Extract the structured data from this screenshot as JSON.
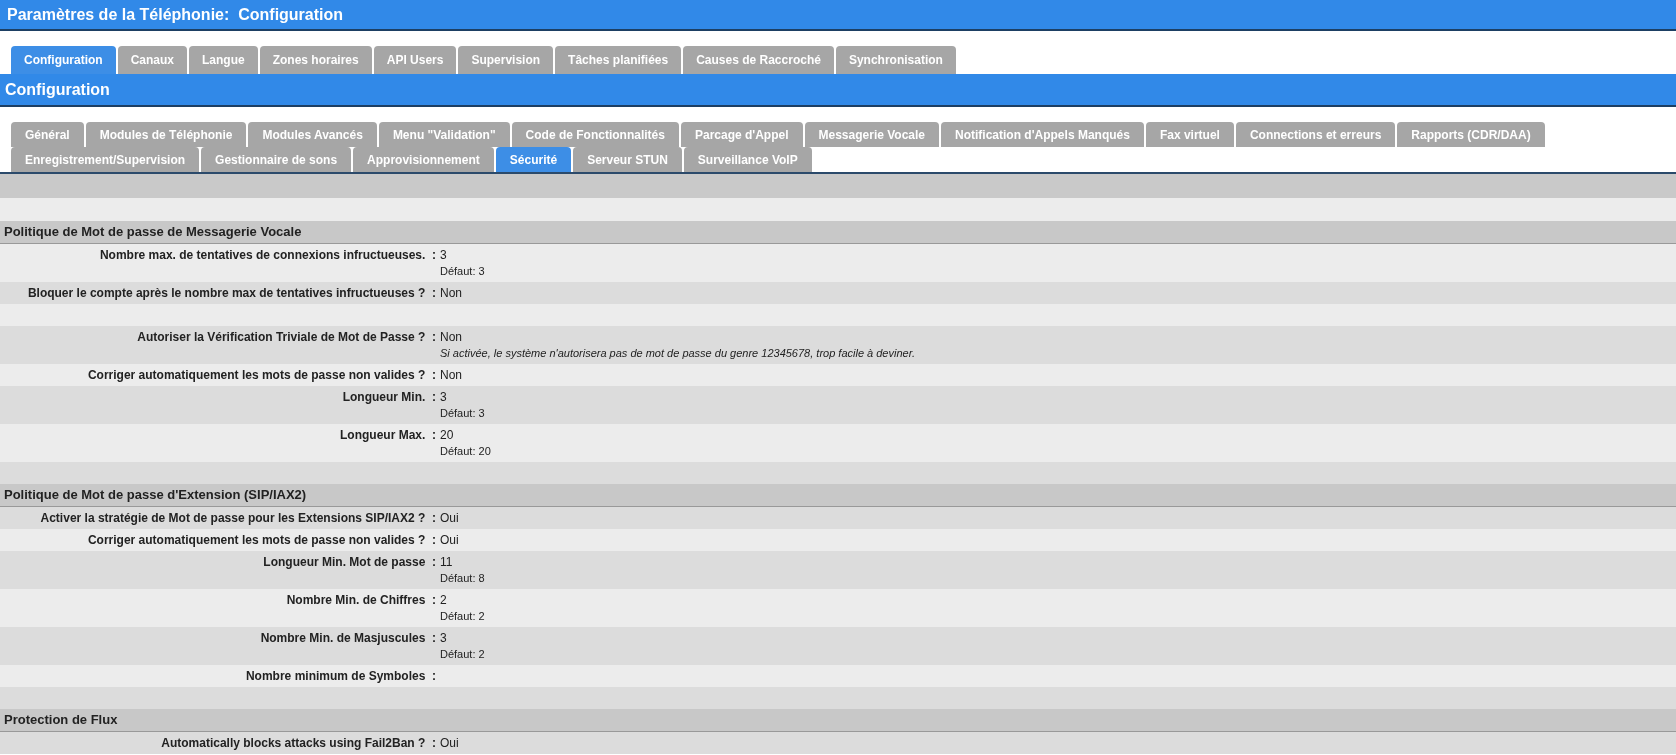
{
  "window": {
    "title": "Paramètres de la Téléphonie:  Configuration"
  },
  "tabs": [
    {
      "label": "Configuration",
      "selected": true
    },
    {
      "label": "Canaux",
      "selected": false
    },
    {
      "label": "Langue",
      "selected": false
    },
    {
      "label": "Zones horaires",
      "selected": false
    },
    {
      "label": "API Users",
      "selected": false
    },
    {
      "label": "Supervision",
      "selected": false
    },
    {
      "label": "Tâches planifiées",
      "selected": false
    },
    {
      "label": "Causes de Raccroché",
      "selected": false
    },
    {
      "label": "Synchronisation",
      "selected": false
    }
  ],
  "panel": {
    "title": "Configuration"
  },
  "section_tabs": [
    {
      "label": "Général",
      "selected": false
    },
    {
      "label": "Modules de Téléphonie",
      "selected": false
    },
    {
      "label": "Modules Avancés",
      "selected": false
    },
    {
      "label": "Menu \"Validation\"",
      "selected": false
    },
    {
      "label": "Code de Fonctionnalités",
      "selected": false
    },
    {
      "label": "Parcage d'Appel",
      "selected": false
    },
    {
      "label": "Messagerie Vocale",
      "selected": false
    },
    {
      "label": "Notification d'Appels Manqués",
      "selected": false
    },
    {
      "label": "Fax virtuel",
      "selected": false
    },
    {
      "label": "Connections et erreurs",
      "selected": false
    },
    {
      "label": "Rapports (CDR/DAA)",
      "selected": false
    },
    {
      "label": "Enregistrement/Supervision",
      "selected": false
    },
    {
      "label": "Gestionnaire de sons",
      "selected": false
    },
    {
      "label": "Approvisionnement",
      "selected": false
    },
    {
      "label": "Sécurité",
      "selected": true
    },
    {
      "label": "Serveur STUN",
      "selected": false
    },
    {
      "label": "Surveillance VoIP",
      "selected": false
    }
  ],
  "sections": [
    {
      "title": "Politique de Mot de passe de Messagerie Vocale",
      "rows": [
        {
          "kind": "field",
          "label": "Nombre max. de tentatives de connexions infructueuses.  :",
          "value": "3",
          "default": "Défaut: 3"
        },
        {
          "kind": "field",
          "label": "Bloquer le compte après le nombre max de tentatives infructueuses ?  :",
          "value": "Non"
        },
        {
          "kind": "spacer"
        },
        {
          "kind": "field",
          "label": "Autoriser la Vérification Triviale de Mot de Passe ?  :",
          "value": "Non",
          "note": "Si activée, le système n'autorisera pas de mot de passe du genre 12345678, trop facile à deviner."
        },
        {
          "kind": "field",
          "label": "Corriger automatiquement les mots de passe non valides ?  :",
          "value": "Non"
        },
        {
          "kind": "field",
          "label": "Longueur Min.  :",
          "value": "3",
          "default": "Défaut: 3"
        },
        {
          "kind": "field",
          "label": "Longueur Max.  :",
          "value": "20",
          "default": "Défaut: 20"
        },
        {
          "kind": "spacer"
        }
      ]
    },
    {
      "title": "Politique de Mot de passe d'Extension (SIP/IAX2)",
      "rows": [
        {
          "kind": "field",
          "label": "Activer la stratégie de Mot de passe pour les Extensions SIP/IAX2 ?  :",
          "value": "Oui"
        },
        {
          "kind": "field",
          "label": "Corriger automatiquement les mots de passe non valides ?  :",
          "value": "Oui"
        },
        {
          "kind": "field",
          "label": "Longueur Min. Mot de passe  :",
          "value": "11",
          "default": "Défaut: 8"
        },
        {
          "kind": "field",
          "label": "Nombre Min. de Chiffres  :",
          "value": "2",
          "default": "Défaut: 2"
        },
        {
          "kind": "field",
          "label": "Nombre Min. de Masjuscules  :",
          "value": "3",
          "default": "Défaut: 2"
        },
        {
          "kind": "field",
          "label": "Nombre minimum de Symboles  :"
        },
        {
          "kind": "spacer"
        }
      ]
    },
    {
      "title": "Protection de Flux",
      "rows": [
        {
          "kind": "field",
          "label": "Automatically blocks attacks using Fail2Ban ?  :",
          "value": "Oui"
        }
      ]
    }
  ]
}
